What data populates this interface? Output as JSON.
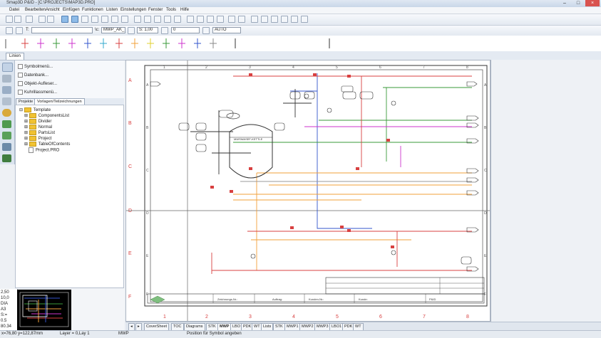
{
  "window": {
    "title": "Smap3D P&ID - [C:\\PROJECTS\\MAP3D.PRO]"
  },
  "menu": [
    "Datei",
    "Bearbeiten",
    "Ansicht",
    "Einfügen",
    "Funktionen",
    "Listen",
    "Einstellungen",
    "Fenster",
    "Tools",
    "Hilfe"
  ],
  "toolbar2": {
    "field1": "",
    "field2": "MWP_AK_",
    "scale": "S: 1,00",
    "value": "0",
    "mode": "AUTO"
  },
  "ribbon_tab": "Linien",
  "panel": {
    "items": [
      "Symbolmenü...",
      "Datenbank...",
      "Objekt-Aufleser...",
      "Kuhrillassmenü..."
    ],
    "tabs": [
      "Projekte",
      "Vorlagen/Teilzeichnungen"
    ],
    "tree": [
      "Template",
      "ComponentsList",
      "Divider",
      "Normal",
      "PartsList",
      "Project",
      "TableOfContents",
      "Project.PRO"
    ]
  },
  "stats": [
    "2,50",
    "10,0",
    "DIA",
    "A3",
    "S:=",
    "0.5",
    "80.34"
  ],
  "drawing": {
    "rows": [
      "A",
      "B",
      "C",
      "D",
      "E",
      "F"
    ],
    "cols": [
      "1",
      "2",
      "3",
      "4",
      "5",
      "6",
      "7",
      "8"
    ],
    "vessel_label": "MWSWASEF-KETTLE",
    "titleblock": [
      "Zeichnungs-Nr.:",
      "Auftrag:",
      "Kunden-Nr.:",
      "Kunde:",
      "P&ID"
    ]
  },
  "sheet_tabs": [
    "CoverSheet",
    "TOC",
    "Diagrams",
    "STK",
    "MWP",
    "LBO",
    "PDK",
    "WT",
    "Lists",
    "STK",
    "MWP1",
    "MWP2",
    "MWP3",
    "LBO1",
    "PDK",
    "WT"
  ],
  "sheet_selected": "MWP",
  "status": {
    "coords": "x=76,80 y=122,87mm",
    "layer": "Layer = 0,Lay 1",
    "mode": "MWP",
    "hint": "Position für Symbol angeben"
  },
  "colors": {
    "accent": "#4f7fb5",
    "green": "#3a9a3a",
    "orange": "#f2a03a",
    "magenta": "#cc33cc",
    "red": "#d84040",
    "blue": "#3355cc"
  }
}
